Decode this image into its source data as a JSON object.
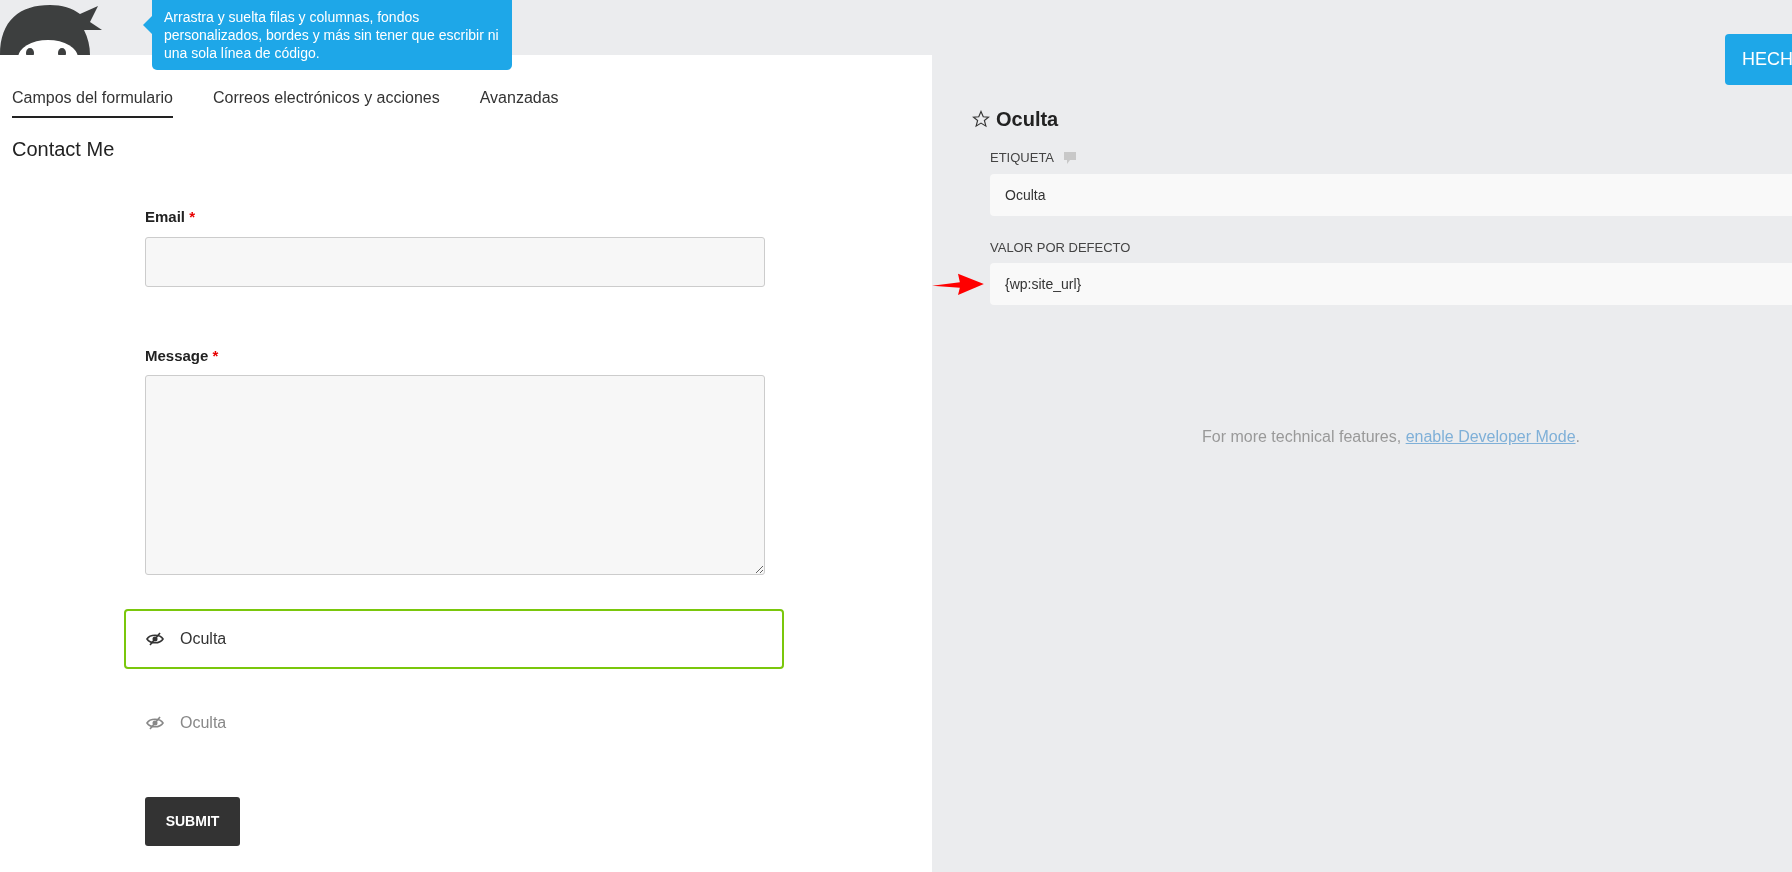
{
  "header": {
    "tooltip": "Arrastra y suelta filas y columnas, fondos personalizados, bordes y más sin tener que escribir ni una sola línea de código."
  },
  "tabs": [
    {
      "label": "Campos del formulario",
      "selected": true
    },
    {
      "label": "Correos electrónicos y acciones",
      "selected": false
    },
    {
      "label": "Avanzadas",
      "selected": false
    }
  ],
  "form": {
    "title": "Contact Me",
    "fields": [
      {
        "kind": "email",
        "label": "Email",
        "required": true,
        "required_mark": "*"
      },
      {
        "kind": "textarea",
        "label": "Message",
        "required": true,
        "required_mark": "*"
      },
      {
        "kind": "hidden",
        "label": "Oculta",
        "selected": true
      },
      {
        "kind": "hidden",
        "label": "Oculta",
        "selected": false
      },
      {
        "kind": "submit",
        "label": "SUBMIT"
      }
    ]
  },
  "settings": {
    "done_button": "HECH",
    "title": "Oculta",
    "fields": [
      {
        "label": "ETIQUETA",
        "help": true,
        "value": "Oculta",
        "arrow": false
      },
      {
        "label": "VALOR POR DEFECTO",
        "help": false,
        "value": "{wp:site_url}",
        "arrow": true
      }
    ],
    "note": "For more technical features, ",
    "note_link": "enable Developer Mode",
    "note_end": "."
  }
}
